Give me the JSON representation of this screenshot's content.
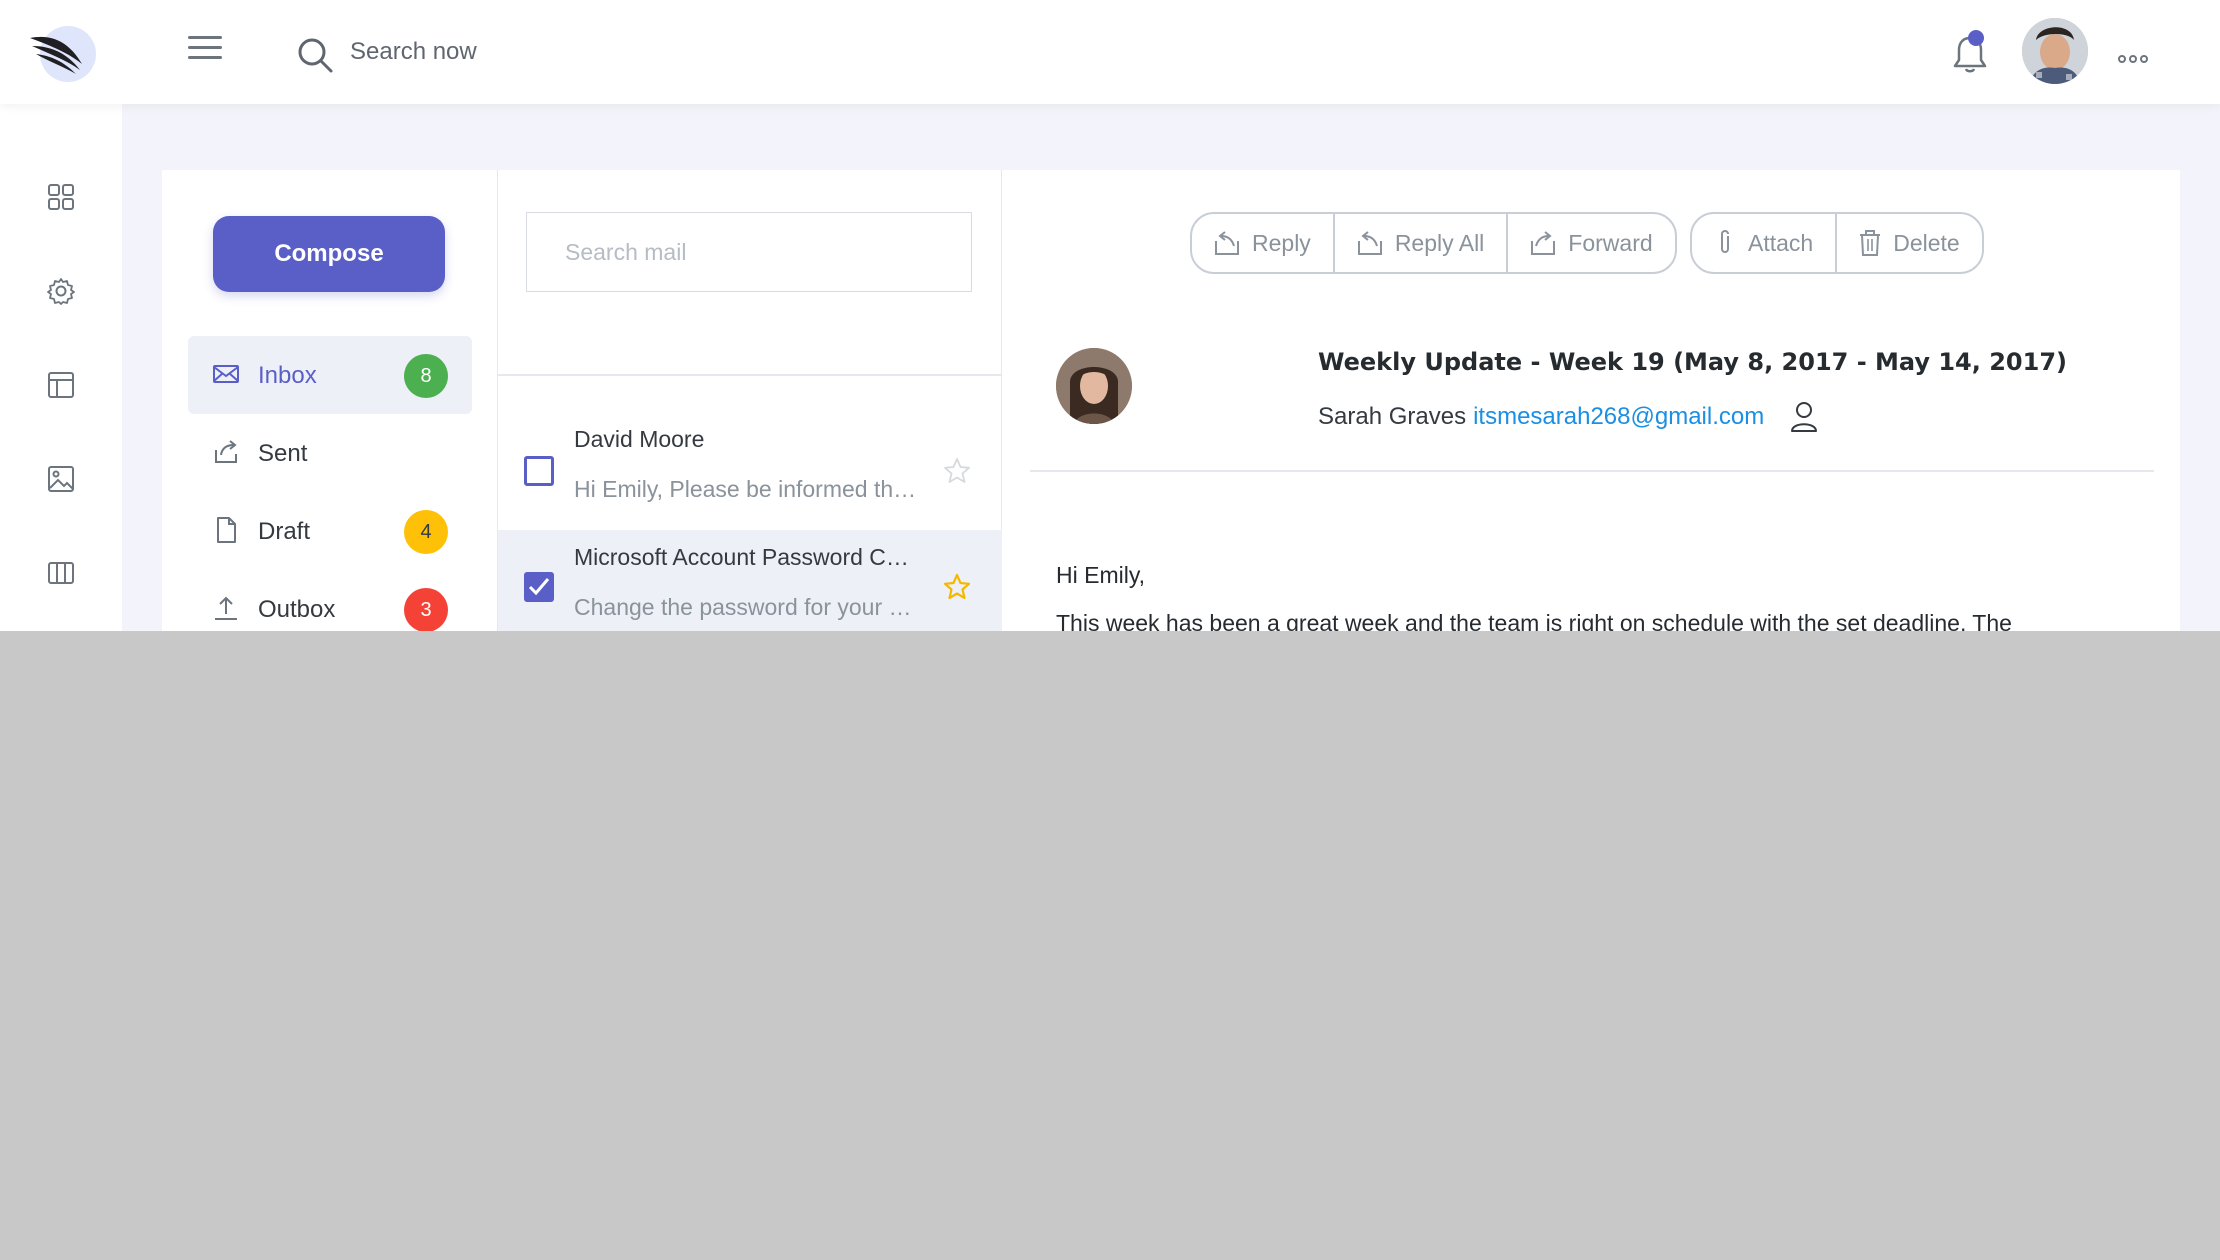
{
  "header": {
    "search_placeholder": "Search now",
    "notification_dot_color": "#5a5fc8"
  },
  "rail": {
    "icons": [
      "dashboard-grid-icon",
      "settings-gear-icon",
      "layout-icon",
      "image-icon",
      "columns-icon"
    ]
  },
  "folders": {
    "compose_label": "Compose",
    "items": [
      {
        "label": "Inbox",
        "icon": "envelope-icon",
        "badge": "8",
        "badge_color": "#4caf50",
        "active": true
      },
      {
        "label": "Sent",
        "icon": "share-icon",
        "badge": "",
        "badge_color": "",
        "active": false
      },
      {
        "label": "Draft",
        "icon": "file-icon",
        "badge": "4",
        "badge_color": "#ffc107",
        "active": false
      },
      {
        "label": "Outbox",
        "icon": "upload-icon",
        "badge": "3",
        "badge_color": "#f44336",
        "active": false
      }
    ]
  },
  "maillist": {
    "search_placeholder": "Search mail",
    "items": [
      {
        "sender": "David Moore",
        "preview": "Hi Emily, Please be informed that the new project",
        "checked": false,
        "starred": false
      },
      {
        "sender": "Microsoft Account Password Change",
        "preview": "Change the password for your Microsoft account",
        "checked": true,
        "starred": true
      }
    ]
  },
  "reader": {
    "toolbar_group1": [
      "Reply",
      "Reply All",
      "Forward"
    ],
    "toolbar_group2": [
      "Attach",
      "Delete"
    ],
    "subject": "Weekly Update - Week 19 (May 8, 2017 - May 14, 2017)",
    "from_name": "Sarah Graves",
    "from_email": "itsmesarah268@gmail.com",
    "greeting": "Hi Emily,",
    "body": "This week has been a great week and the team is right on schedule with the set deadline. The"
  },
  "colors": {
    "accent": "#5a5fc8",
    "link": "#1a8fe3",
    "star": "#f5b800"
  }
}
